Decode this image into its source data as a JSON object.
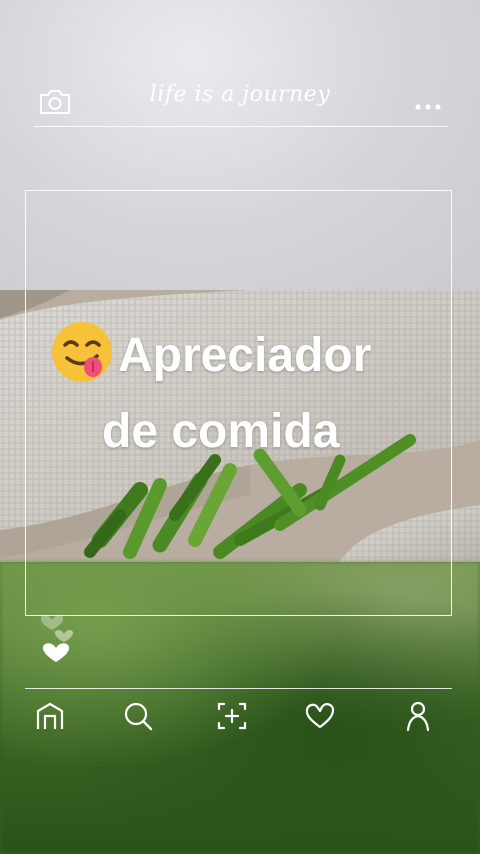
{
  "header": {
    "title": "life is a journey",
    "left_icon": "camera-icon",
    "right_icon": "more-dots-icon"
  },
  "post": {
    "caption_line1": "Apreciador",
    "caption_line2": "de comida",
    "emoji": "face-savoring-food-emoji",
    "reaction_icons": [
      "heart-outline-icon",
      "heart-outline-icon",
      "heart-filled-icon"
    ]
  },
  "bottom_nav": {
    "items": [
      {
        "name": "home",
        "icon": "home-icon"
      },
      {
        "name": "search",
        "icon": "search-icon"
      },
      {
        "name": "add",
        "icon": "add-post-icon"
      },
      {
        "name": "likes",
        "icon": "heart-icon"
      },
      {
        "name": "profile",
        "icon": "profile-icon"
      }
    ]
  },
  "colors": {
    "foreground": "#ffffff",
    "emoji_face": "#f7c23a",
    "tongue": "#ee4f79",
    "okra_green": "#4b8a22"
  }
}
